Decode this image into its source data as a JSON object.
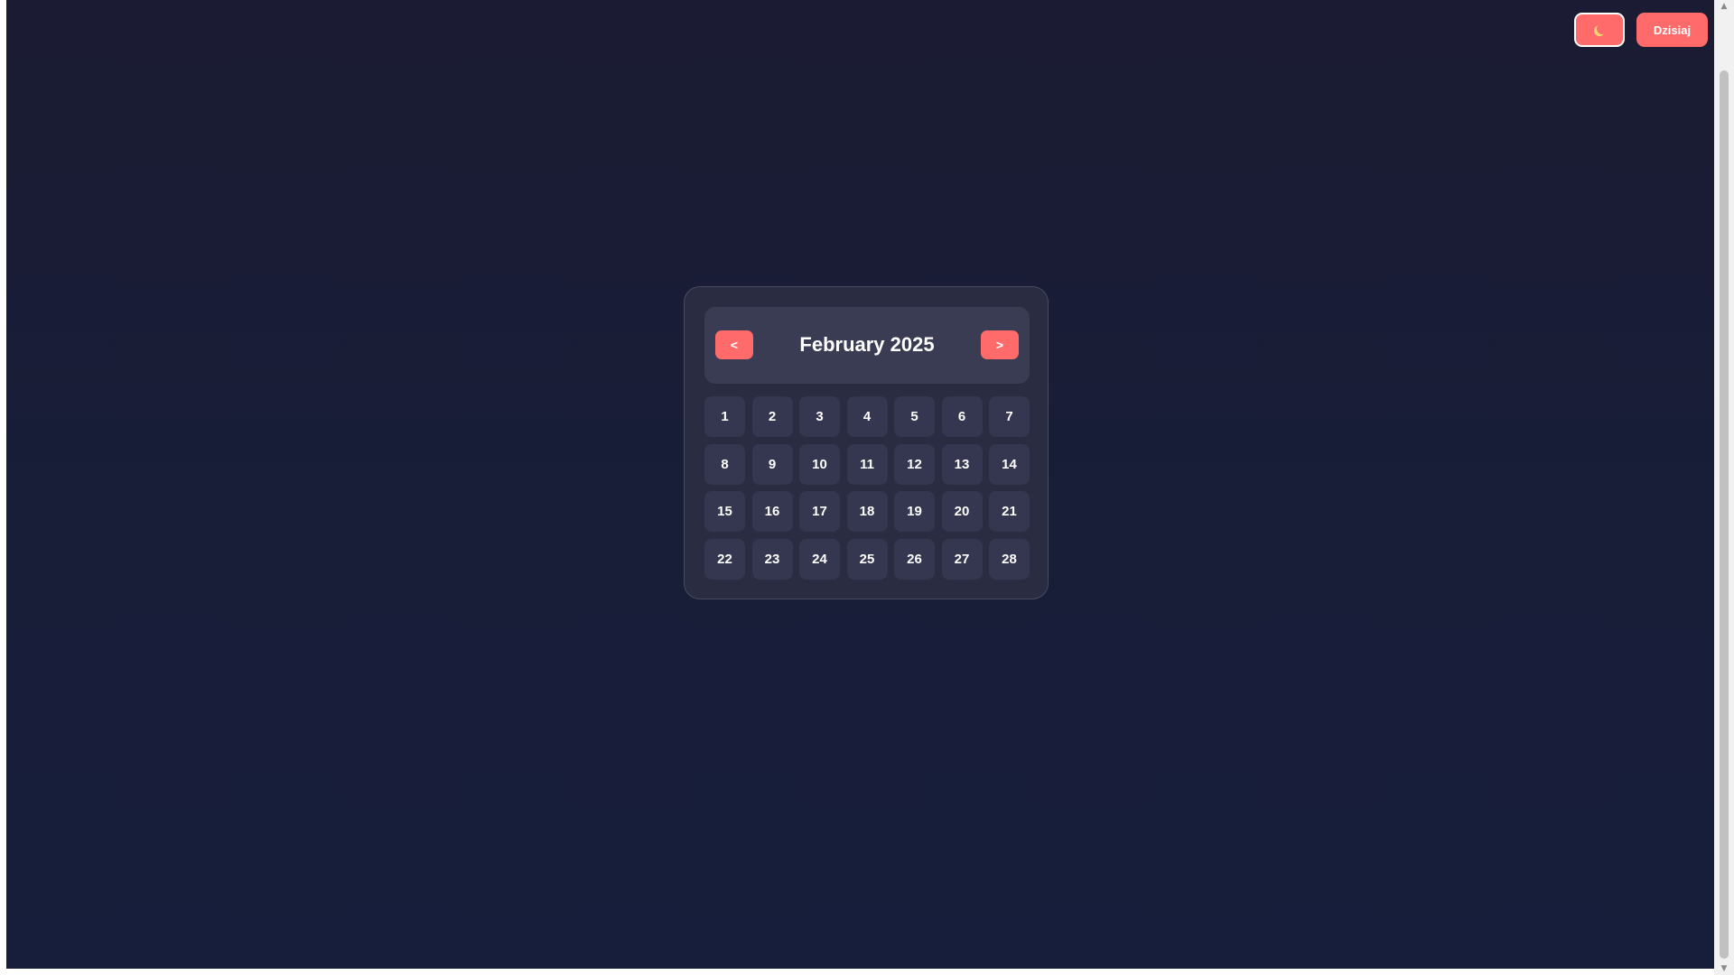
{
  "toolbar": {
    "theme_icon": "moon-icon",
    "today_label": "Dzisiaj"
  },
  "calendar": {
    "month_title": "February 2025",
    "prev_label": "<",
    "next_label": ">",
    "days": [
      "1",
      "2",
      "3",
      "4",
      "5",
      "6",
      "7",
      "8",
      "9",
      "10",
      "11",
      "12",
      "13",
      "14",
      "15",
      "16",
      "17",
      "18",
      "19",
      "20",
      "21",
      "22",
      "23",
      "24",
      "25",
      "26",
      "27",
      "28"
    ]
  },
  "colors": {
    "accent": "#ff6b6b",
    "background": "#1a1c30",
    "card": "#2a2c42",
    "day_cell": "#353750",
    "text": "#ffffff"
  }
}
